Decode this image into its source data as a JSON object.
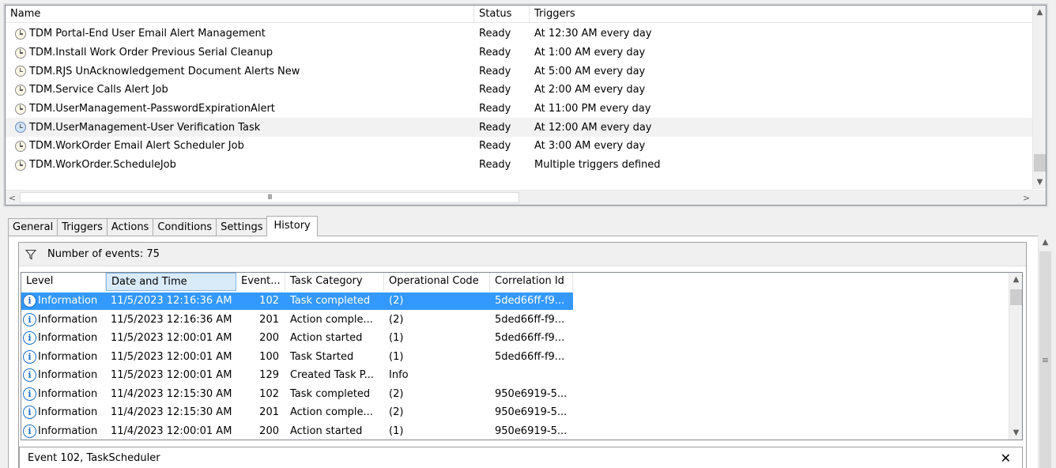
{
  "task_list": {
    "columns": {
      "name": "Name",
      "status": "Status",
      "triggers": "Triggers"
    },
    "rows": [
      {
        "name": "TDM Portal-End User Email Alert Management",
        "status": "Ready",
        "triggers": "At 12:30 AM every day"
      },
      {
        "name": "TDM.Install Work Order Previous Serial Cleanup",
        "status": "Ready",
        "triggers": "At 1:00 AM every day"
      },
      {
        "name": "TDM.RJS UnAcknowledgement Document Alerts New",
        "status": "Ready",
        "triggers": "At 5:00 AM every day"
      },
      {
        "name": "TDM.Service Calls Alert Job",
        "status": "Ready",
        "triggers": "At 2:00 AM every day"
      },
      {
        "name": "TDM.UserManagement-PasswordExpirationAlert",
        "status": "Ready",
        "triggers": "At 11:00 PM every day"
      },
      {
        "name": "TDM.UserManagement-User Verification Task",
        "status": "Ready",
        "triggers": "At 12:00 AM every day"
      },
      {
        "name": "TDM.WorkOrder Email Alert Scheduler Job",
        "status": "Ready",
        "triggers": "At 3:00 AM every day"
      },
      {
        "name": "TDM.WorkOrder.ScheduleJob",
        "status": "Ready",
        "triggers": "Multiple triggers defined"
      }
    ],
    "selected_index": 5,
    "hscroll_grip": "III"
  },
  "tabs": [
    "General",
    "Triggers",
    "Actions",
    "Conditions",
    "Settings",
    "History"
  ],
  "active_tab": "History",
  "history": {
    "event_count_label": "Number of events: 75",
    "columns": {
      "level": "Level",
      "date": "Date and Time",
      "event_id": "Event...",
      "category": "Task Category",
      "op_code": "Operational Code",
      "correlation": "Correlation Id"
    },
    "rows": [
      {
        "level": "Information",
        "date": "11/5/2023 12:16:36 AM",
        "event_id": "102",
        "category": "Task completed",
        "op_code": "(2)",
        "correlation": "5ded66ff-f9..."
      },
      {
        "level": "Information",
        "date": "11/5/2023 12:16:36 AM",
        "event_id": "201",
        "category": "Action comple...",
        "op_code": "(2)",
        "correlation": "5ded66ff-f9..."
      },
      {
        "level": "Information",
        "date": "11/5/2023 12:00:01 AM",
        "event_id": "200",
        "category": "Action started",
        "op_code": "(1)",
        "correlation": "5ded66ff-f9..."
      },
      {
        "level": "Information",
        "date": "11/5/2023 12:00:01 AM",
        "event_id": "100",
        "category": "Task Started",
        "op_code": "(1)",
        "correlation": "5ded66ff-f9..."
      },
      {
        "level": "Information",
        "date": "11/5/2023 12:00:01 AM",
        "event_id": "129",
        "category": "Created Task P...",
        "op_code": "Info",
        "correlation": ""
      },
      {
        "level": "Information",
        "date": "11/4/2023 12:15:30 AM",
        "event_id": "102",
        "category": "Task completed",
        "op_code": "(2)",
        "correlation": "950e6919-5..."
      },
      {
        "level": "Information",
        "date": "11/4/2023 12:15:30 AM",
        "event_id": "201",
        "category": "Action comple...",
        "op_code": "(2)",
        "correlation": "950e6919-5..."
      },
      {
        "level": "Information",
        "date": "11/4/2023 12:00:01 AM",
        "event_id": "200",
        "category": "Action started",
        "op_code": "(1)",
        "correlation": "950e6919-5..."
      }
    ],
    "selected_index": 0,
    "detail_title": "Event 102, TaskScheduler",
    "close_glyph": "✕",
    "outer_scroll_grip": "≡"
  },
  "colors": {
    "selection": "#3399ff",
    "row_highlight": "#f2f2f2",
    "info_icon": "#1a6fc6"
  }
}
